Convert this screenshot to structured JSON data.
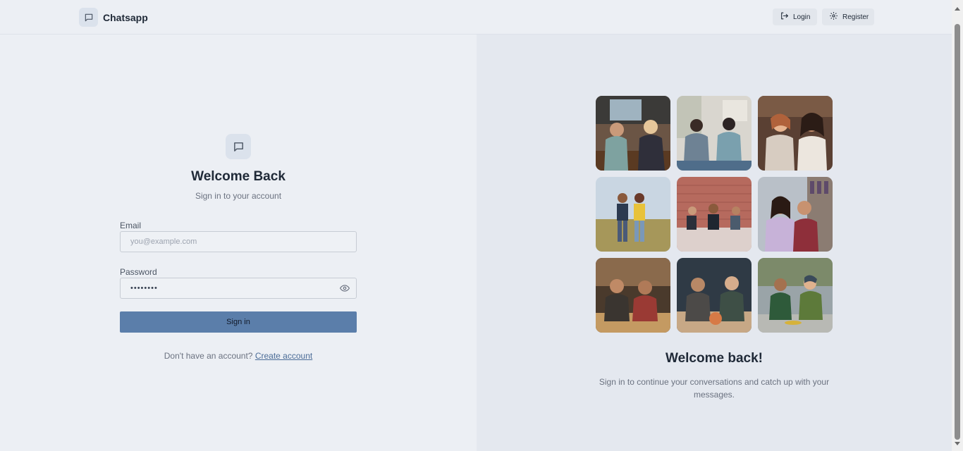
{
  "header": {
    "brand_name": "Chatsapp",
    "login_label": "Login",
    "register_label": "Register"
  },
  "form": {
    "title": "Welcome Back",
    "subtitle": "Sign in to your account",
    "email_label": "Email",
    "email_placeholder": "you@example.com",
    "password_label": "Password",
    "password_value": "••••••••",
    "signin_label": "Sign in",
    "signup_prompt": "Don't have an account?",
    "signup_link": "Create account"
  },
  "showcase": {
    "title": "Welcome back!",
    "subtitle": "Sign in to continue your conversations and catch up with your messages."
  },
  "colors": {
    "background": "#eceff4",
    "panel": "#e4e8ef",
    "primary_button": "#5b7eaa",
    "link": "#4b6c97"
  }
}
